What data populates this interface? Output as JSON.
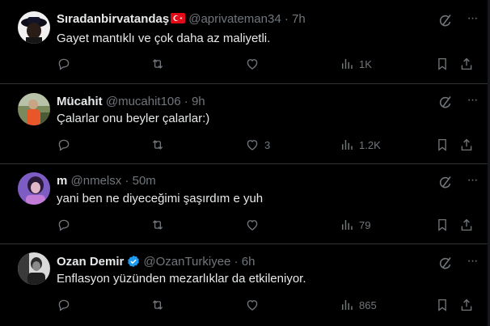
{
  "tweets": [
    {
      "name": "Sıradanbirvatandaş",
      "flag": "turkey-flag-emoji",
      "handle": "@aprivateman34",
      "time": "7h",
      "text": "Gayet mantıklı ve çok daha az maliyetli.",
      "replies": "",
      "retweets": "",
      "likes": "",
      "views": "1K"
    },
    {
      "name": "Mücahit",
      "handle": "@mucahit106",
      "time": "9h",
      "text": "Çalarlar onu beyler çalarlar:)",
      "replies": "",
      "retweets": "",
      "likes": "3",
      "views": "1.2K"
    },
    {
      "name": "m",
      "handle": "@nmelsx",
      "time": "50m",
      "text": "yani ben ne diyeceğimi şaşırdım e yuh",
      "replies": "",
      "retweets": "",
      "likes": "",
      "views": "79"
    },
    {
      "name": "Ozan Demir",
      "verified": true,
      "handle": "@OzanTurkiyee",
      "time": "6h",
      "text": "Enflasyon yüzünden mezarlıklar da etkileniyor.",
      "replies": "",
      "retweets": "",
      "likes": "",
      "views": "865"
    }
  ],
  "separator": "·",
  "colors": {
    "background": "#000000",
    "text": "#e7e9ea",
    "muted": "#71767b",
    "border": "#2f3336",
    "verified": "#1d9bf0"
  }
}
